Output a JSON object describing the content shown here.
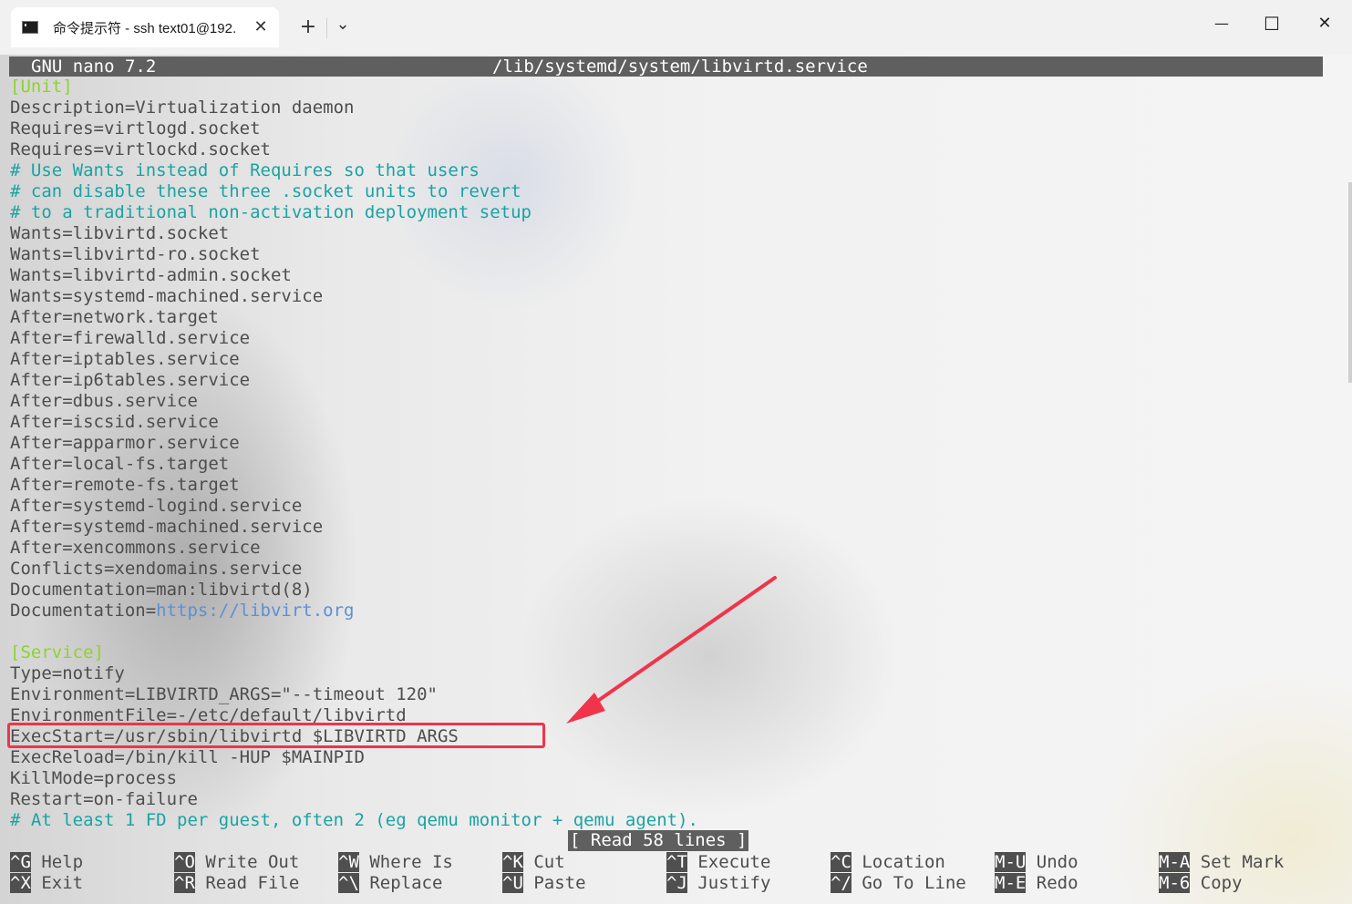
{
  "titlebar": {
    "tab_title": "命令提示符 - ssh  text01@192.",
    "tab_close": "✕",
    "new_tab": "+",
    "dropdown": "⌄",
    "minimize": "—",
    "maximize": "☐",
    "close": "✕",
    "icons": [
      "terminal-icon",
      "close-icon",
      "plus-icon",
      "chevron-down-icon",
      "minimize-icon",
      "maximize-icon",
      "close-window-icon"
    ]
  },
  "nano": {
    "app": "GNU nano 7.2",
    "file": "/lib/systemd/system/libvirtd.service",
    "lines": [
      {
        "t": "[Unit]",
        "k": "sec"
      },
      {
        "t": "Description=Virtualization daemon",
        "k": ""
      },
      {
        "t": "Requires=virtlogd.socket",
        "k": ""
      },
      {
        "t": "Requires=virtlockd.socket",
        "k": ""
      },
      {
        "t": "# Use Wants instead of Requires so that users",
        "k": "cmt"
      },
      {
        "t": "# can disable these three .socket units to revert",
        "k": "cmt"
      },
      {
        "t": "# to a traditional non-activation deployment setup",
        "k": "cmt"
      },
      {
        "t": "Wants=libvirtd.socket",
        "k": ""
      },
      {
        "t": "Wants=libvirtd-ro.socket",
        "k": ""
      },
      {
        "t": "Wants=libvirtd-admin.socket",
        "k": ""
      },
      {
        "t": "Wants=systemd-machined.service",
        "k": ""
      },
      {
        "t": "After=network.target",
        "k": ""
      },
      {
        "t": "After=firewalld.service",
        "k": ""
      },
      {
        "t": "After=iptables.service",
        "k": ""
      },
      {
        "t": "After=ip6tables.service",
        "k": ""
      },
      {
        "t": "After=dbus.service",
        "k": ""
      },
      {
        "t": "After=iscsid.service",
        "k": ""
      },
      {
        "t": "After=apparmor.service",
        "k": ""
      },
      {
        "t": "After=local-fs.target",
        "k": ""
      },
      {
        "t": "After=remote-fs.target",
        "k": ""
      },
      {
        "t": "After=systemd-logind.service",
        "k": ""
      },
      {
        "t": "After=systemd-machined.service",
        "k": ""
      },
      {
        "t": "After=xencommons.service",
        "k": ""
      },
      {
        "t": "Conflicts=xendomains.service",
        "k": ""
      },
      {
        "t": "Documentation=man:libvirtd(8)",
        "k": ""
      },
      {
        "t": "Documentation=",
        "k": "",
        "url": "https://libvirt.org"
      },
      {
        "t": "",
        "k": ""
      },
      {
        "t": "[Service]",
        "k": "sec"
      },
      {
        "t": "Type=notify",
        "k": ""
      },
      {
        "t": "Environment=LIBVIRTD_ARGS=\"--timeout 120\"",
        "k": ""
      },
      {
        "t": "EnvironmentFile=-/etc/default/libvirtd",
        "k": ""
      },
      {
        "t": "ExecStart=/usr/sbin/libvirtd $LIBVIRTD_ARGS",
        "k": ""
      },
      {
        "t": "ExecReload=/bin/kill -HUP $MAINPID",
        "k": ""
      },
      {
        "t": "KillMode=process",
        "k": ""
      },
      {
        "t": "Restart=on-failure",
        "k": ""
      },
      {
        "t": "# At least 1 FD per guest, often 2 (eg qemu monitor + qemu agent).",
        "k": "cmt"
      }
    ],
    "status": "[ Read 58 lines ]",
    "shortcuts": [
      {
        "key": "^G",
        "label": "Help"
      },
      {
        "key": "^X",
        "label": "Exit"
      },
      {
        "key": "^O",
        "label": "Write Out"
      },
      {
        "key": "^R",
        "label": "Read File"
      },
      {
        "key": "^W",
        "label": "Where Is"
      },
      {
        "key": "^\\",
        "label": "Replace"
      },
      {
        "key": "^K",
        "label": "Cut"
      },
      {
        "key": "^U",
        "label": "Paste"
      },
      {
        "key": "^T",
        "label": "Execute"
      },
      {
        "key": "^J",
        "label": "Justify"
      },
      {
        "key": "^C",
        "label": "Location"
      },
      {
        "key": "^/",
        "label": "Go To Line"
      },
      {
        "key": "M-U",
        "label": "Undo"
      },
      {
        "key": "M-E",
        "label": "Redo"
      },
      {
        "key": "M-A",
        "label": "Set Mark"
      },
      {
        "key": "M-6",
        "label": "Copy"
      }
    ]
  },
  "annotation": {
    "highlight_color": "#f0344a"
  }
}
